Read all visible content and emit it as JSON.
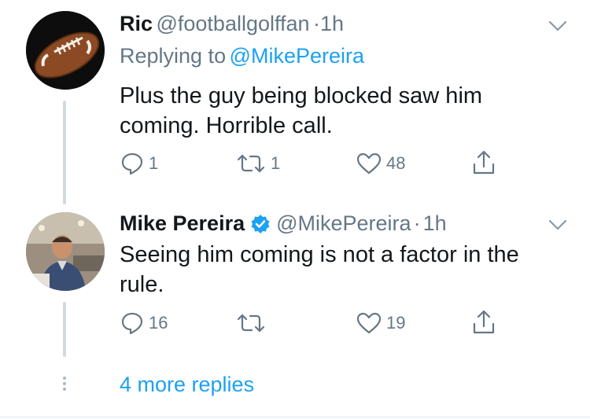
{
  "tweets": [
    {
      "name": "Ric",
      "handle": "@footballgolffan",
      "separator": "·",
      "time": "1h",
      "replying_prefix": "Replying to",
      "replying_to": "@MikePereira",
      "lines": [
        "Plus the guy being blocked saw him",
        "coming. Horrible call."
      ],
      "reply_count": "1",
      "retweet_count": "1",
      "like_count": "48"
    },
    {
      "name": "Mike Pereira",
      "handle": "@MikePereira",
      "separator": "·",
      "time": "1h",
      "lines": [
        "Seeing him coming is not a factor in the",
        "rule."
      ],
      "reply_count": "16",
      "retweet_count": "",
      "like_count": "19",
      "verified": true
    }
  ],
  "more_replies": "4 more replies",
  "colors": {
    "accent": "#1da1f2",
    "secondary": "#657786",
    "verified": "#1da1f2"
  },
  "icons": [
    "chevron-down-icon",
    "reply-icon",
    "retweet-icon",
    "like-icon",
    "share-icon",
    "verified-badge-icon",
    "more-dots-icon"
  ]
}
